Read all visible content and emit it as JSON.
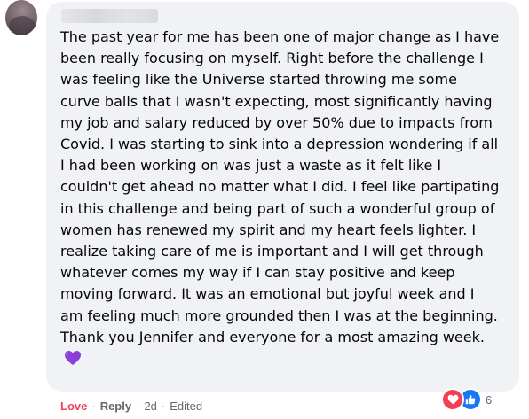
{
  "comment": {
    "author_name": "",
    "text": "The past year for me has been one of major change as I have been really focusing on myself. Right before the challenge I was feeling like the Universe started throwing me some curve balls that I wasn't expecting, most significantly having my job and salary reduced by over 50% due to impacts from Covid. I was starting to sink into a depression wondering if all I had been working on was just a waste as it felt like I couldn't get ahead no matter what I did. I feel like partipating in this challenge and being part of such a wonderful group of women has renewed my spirit and my heart feels lighter. I realize taking care of me is important and I will get through whatever comes my way if I can stay positive and keep moving forward. It was an emotional but joyful week and I am feeling much more grounded then I was at the beginning. Thank you Jennifer and everyone for a most amazing week.",
    "trailing_emoji": "purple-heart-icon"
  },
  "actions": {
    "love_label": "Love",
    "reply_label": "Reply",
    "separator": "·",
    "time": "2d",
    "edited_label": "Edited"
  },
  "reactions": {
    "types": [
      "love-reaction-icon",
      "like-reaction-icon"
    ],
    "count": "6"
  },
  "colors": {
    "bubble_bg": "#f0f2f5",
    "text": "#050505",
    "meta": "#65676b",
    "love": "#f33e58",
    "like": "#1877f2",
    "purple_heart": "#8b3fd9"
  }
}
